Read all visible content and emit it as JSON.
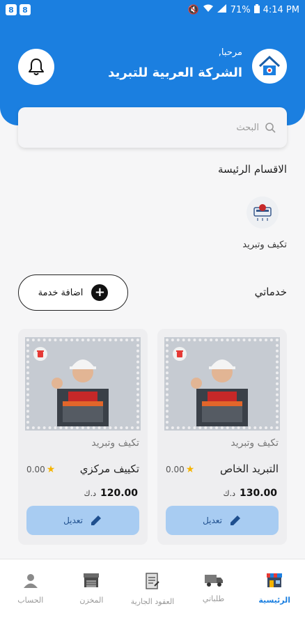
{
  "status_bar": {
    "battery": "71%",
    "time": "4:14 PM",
    "app_icons": [
      "8",
      "8"
    ]
  },
  "header": {
    "greeting": "مرحبا,",
    "company_name": "الشركة العربية للتبريد"
  },
  "search": {
    "placeholder": "البحث"
  },
  "main_sections": {
    "title": "الاقسام الرئيسة",
    "items": [
      {
        "label": "تكيف وتبريد",
        "icon": "ac-unit-icon"
      }
    ]
  },
  "my_services": {
    "title": "خدماتي",
    "add_button_label": "اضافة خدمة",
    "cards": [
      {
        "category": "تكيف وتبريد",
        "name": "التبريد الخاص",
        "rating": "0.00",
        "price": "130.00",
        "currency": "د.ك",
        "edit_label": "تعديل"
      },
      {
        "category": "تكيف وتبريد",
        "name": "تكييف مركزي",
        "rating": "0.00",
        "price": "120.00",
        "currency": "د.ك",
        "edit_label": "تعديل"
      }
    ]
  },
  "bottom_nav": {
    "items": [
      {
        "label": "الرئيسية",
        "icon": "store-icon",
        "active": true
      },
      {
        "label": "طلباتي",
        "icon": "truck-icon",
        "active": false
      },
      {
        "label": "العقود الجارية",
        "icon": "contract-icon",
        "active": false
      },
      {
        "label": "المخزن",
        "icon": "warehouse-icon",
        "active": false
      },
      {
        "label": "الحساب",
        "icon": "user-icon",
        "active": false
      }
    ]
  },
  "colors": {
    "primary": "#1b7fe0",
    "edit_button": "#a8ccf2",
    "star": "#f5b400",
    "delete": "#e53935"
  }
}
